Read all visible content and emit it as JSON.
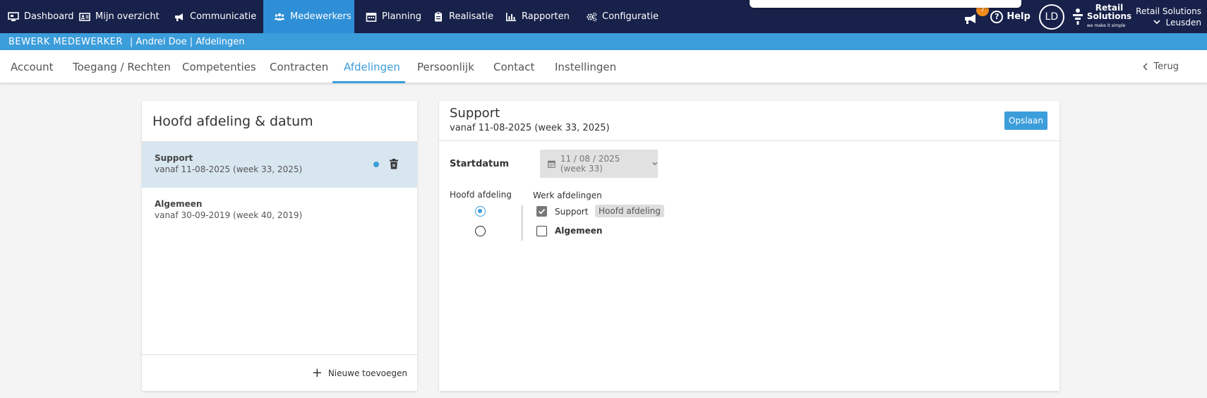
{
  "nav": {
    "items": [
      {
        "label": "Dashboard",
        "icon": "monitor-icon"
      },
      {
        "label": "Mijn overzicht",
        "icon": "id-card-icon"
      },
      {
        "label": "Communicatie",
        "icon": "megaphone-icon"
      },
      {
        "label": "Medewerkers",
        "icon": "users-icon",
        "active": true
      },
      {
        "label": "Planning",
        "icon": "calendar-icon"
      },
      {
        "label": "Realisatie",
        "icon": "clipboard-icon"
      },
      {
        "label": "Rapporten",
        "icon": "bar-chart-icon"
      },
      {
        "label": "Configuratie",
        "icon": "gears-icon"
      }
    ],
    "notifications_count": "7",
    "help_label": "Help",
    "avatar_initials": "LD",
    "logo_line1": "Retail",
    "logo_line2": "Solutions",
    "logo_tagline": "we make it simple",
    "company_name": "Retail Solutions",
    "location": "Leusden"
  },
  "subheader": {
    "title": "BEWERK MEDEWERKER",
    "breadcrumb": "| Andrei Doe | Afdelingen"
  },
  "tabs": [
    {
      "label": "Account"
    },
    {
      "label": "Toegang / Rechten"
    },
    {
      "label": "Competenties"
    },
    {
      "label": "Contracten"
    },
    {
      "label": "Afdelingen",
      "active": true
    },
    {
      "label": "Persoonlijk"
    },
    {
      "label": "Contact"
    },
    {
      "label": "Instellingen"
    }
  ],
  "back_label": "Terug",
  "left_panel": {
    "title": "Hoofd afdeling & datum",
    "items": [
      {
        "name": "Support",
        "date": "vanaf 11-08-2025 (week 33, 2025)",
        "selected": true
      },
      {
        "name": "Algemeen",
        "date": "vanaf 30-09-2019 (week 40, 2019)"
      }
    ],
    "add_label": "Nieuwe toevoegen"
  },
  "right_panel": {
    "title": "Support",
    "subtitle": "vanaf 11-08-2025 (week 33, 2025)",
    "save_label": "Opslaan",
    "start_label": "Startdatum",
    "start_value": "11 / 08 / 2025 (week 33)",
    "hoofd_label": "Hoofd afdeling",
    "werk_label": "Werk afdelingen",
    "departments": [
      {
        "name": "Support",
        "checked": true,
        "primary": true,
        "tag": "Hoofd afdeling"
      },
      {
        "name": "Algemeen",
        "checked": false,
        "primary": false
      }
    ]
  },
  "colors": {
    "nav_bg": "#17214a",
    "accent": "#3c9ddb",
    "active_nav": "#2e8fd6",
    "badge": "#f28c1b"
  }
}
